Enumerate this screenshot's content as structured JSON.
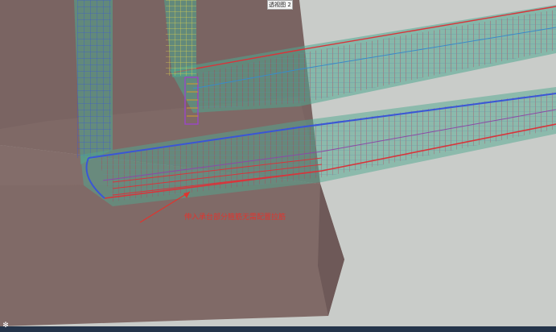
{
  "viewport": {
    "view_label": "透视图 2",
    "annotation_text": "伸入承台部分箍筋无需配置拉筋"
  },
  "status_bar": {
    "icon": "gear-icon"
  },
  "colors": {
    "background": "#c9ccc9",
    "pile_cap": "#7b6563",
    "pile_cap_light": "#8e7a76",
    "beam_glass": "#4fa890",
    "rebar_blue": "#3a56d6",
    "rebar_red": "#d8343a",
    "rebar_yellow": "#e2d64a",
    "rebar_purple": "#9a46c8",
    "annotation_red": "#e0342e",
    "status_bar": "#24344a"
  }
}
